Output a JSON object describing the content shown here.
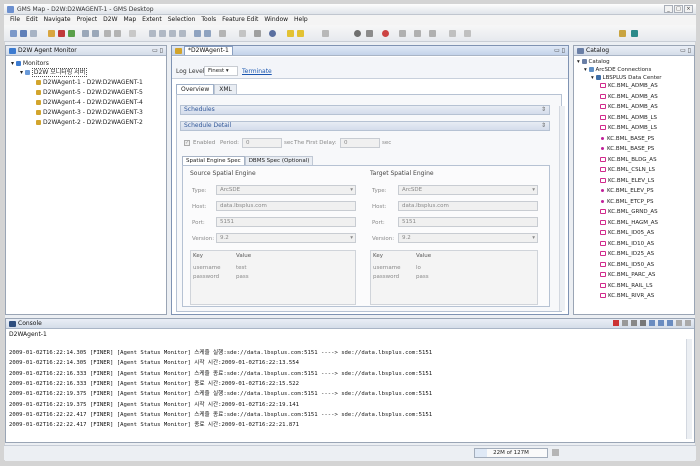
{
  "window": {
    "title": "GMS Map - D2W:D2WAGENT-1 - GMS Desktop"
  },
  "menu": [
    "File",
    "Edit",
    "Navigate",
    "Project",
    "D2W",
    "Map",
    "Extent",
    "Selection",
    "Tools",
    "Feature Edit",
    "Window",
    "Help"
  ],
  "monitor": {
    "tab_label": "D2W Agent Monitor",
    "root": "Monitors",
    "group": "D2W 모니터링 서버",
    "agents": [
      "D2WAgent-1 - D2W:D2WAGENT-1",
      "D2WAgent-5 - D2W:D2WAGENT-5",
      "D2WAgent-4 - D2W:D2WAGENT-4",
      "D2WAgent-3 - D2W:D2WAGENT-3",
      "D2WAgent-2 - D2W:D2WAGENT-2"
    ]
  },
  "editor": {
    "tab_label": "*D2WAgent-1",
    "log_level_label": "Log Level:",
    "log_level_value": "Finest",
    "terminate_link": "Terminate",
    "subtabs": [
      "Overview",
      "XML"
    ],
    "schedules_label": "Schedules",
    "schedule_detail_label": "Schedule Detail",
    "enabled_label": "Enabled",
    "period_label": "Period:",
    "period_value": "0",
    "period_unit": "sec",
    "first_delay_label": "The First Delay:",
    "first_delay_value": "0",
    "first_delay_unit": "sec",
    "engine_tabs": [
      "Spatial Engine Spec",
      "DBMS Spec (Optional)"
    ],
    "source": {
      "title": "Source Spatial Engine",
      "type_label": "Type:",
      "type_value": "ArcSDE",
      "host_label": "Host:",
      "host_value": "data.lbsplus.com",
      "port_label": "Port:",
      "port_value": "5151",
      "version_label": "Version:",
      "version_value": "9.2",
      "key_header": "Key",
      "value_header": "Value",
      "rows": [
        {
          "key": "username",
          "value": "test"
        },
        {
          "key": "password",
          "value": "pass"
        }
      ]
    },
    "target": {
      "title": "Target Spatial Engine",
      "type_label": "Type:",
      "type_value": "ArcSDE",
      "host_label": "Host:",
      "host_value": "data.lbsplus.com",
      "port_label": "Port:",
      "port_value": "5151",
      "version_label": "Version:",
      "version_value": "9.2",
      "key_header": "Key",
      "value_header": "Value",
      "rows": [
        {
          "key": "username",
          "value": "lo"
        },
        {
          "key": "password",
          "value": "pass"
        }
      ]
    }
  },
  "catalog": {
    "tab_label": "Catalog",
    "root": "Catalog",
    "connections": "ArcSDE Connections",
    "center": "LBSPLUS Data Center",
    "items": [
      "KC.BML_ADMB_AS",
      "KC.BML_ADMB_AS",
      "KC.BML_ADMB_AS",
      "KC.BML_ADMB_LS",
      "KC.BML_ADMB_LS",
      "KC.BML_BASE_PS",
      "KC.BML_BASE_PS",
      "KC.BML_BLDG_AS",
      "KC.BML_CSLN_LS",
      "KC.BML_ELEV_LS",
      "KC.BML_ELEV_PS",
      "KC.BML_ETCP_PS",
      "KC.BML_GRND_AS",
      "KC.BML_HAGM_AS",
      "KC.BML_ID05_AS",
      "KC.BML_ID10_AS",
      "KC.BML_ID25_AS",
      "KC.BML_ID50_AS",
      "KC.BML_PARC_AS",
      "KC.BML_RAIL_LS",
      "KC.BML_RIVR_AS"
    ]
  },
  "console": {
    "tab_label": "Console",
    "header": "D2WAgent-1",
    "lines": [
      "2009-01-02T16:22:14.305 [FINER] [Agent Status Monitor] 스케줄 실행:sde://data.lbsplus.com:5151  ---->  sde://data.lbsplus.com:5151",
      "2009-01-02T16:22:14.305 [FINER] [Agent Status Monitor] 시작 시간:2009-01-02T16:22:13.554",
      "2009-01-02T16:22:16.333 [FINER] [Agent Status Monitor] 스케줄 종료:sde://data.lbsplus.com:5151  ---->  sde://data.lbsplus.com:5151",
      "2009-01-02T16:22:16.333 [FINER] [Agent Status Monitor] 종료 시간:2009-01-02T16:22:15.522",
      "2009-01-02T16:22:19.375 [FINER] [Agent Status Monitor] 스케줄 실행:sde://data.lbsplus.com:5151  ---->  sde://data.lbsplus.com:5151",
      "2009-01-02T16:22:19.375 [FINER] [Agent Status Monitor] 시작 시간:2009-01-02T16:22:19.141",
      "2009-01-02T16:22:22.417 [FINER] [Agent Status Monitor] 스케줄 종료:sde://data.lbsplus.com:5151  ---->  sde://data.lbsplus.com:5151",
      "2009-01-02T16:22:22.417 [FINER] [Agent Status Monitor] 종료 시간:2009-01-02T16:22:21.871"
    ]
  },
  "status": {
    "memory": "22M of 127M",
    "memory_fraction": 0.17
  }
}
